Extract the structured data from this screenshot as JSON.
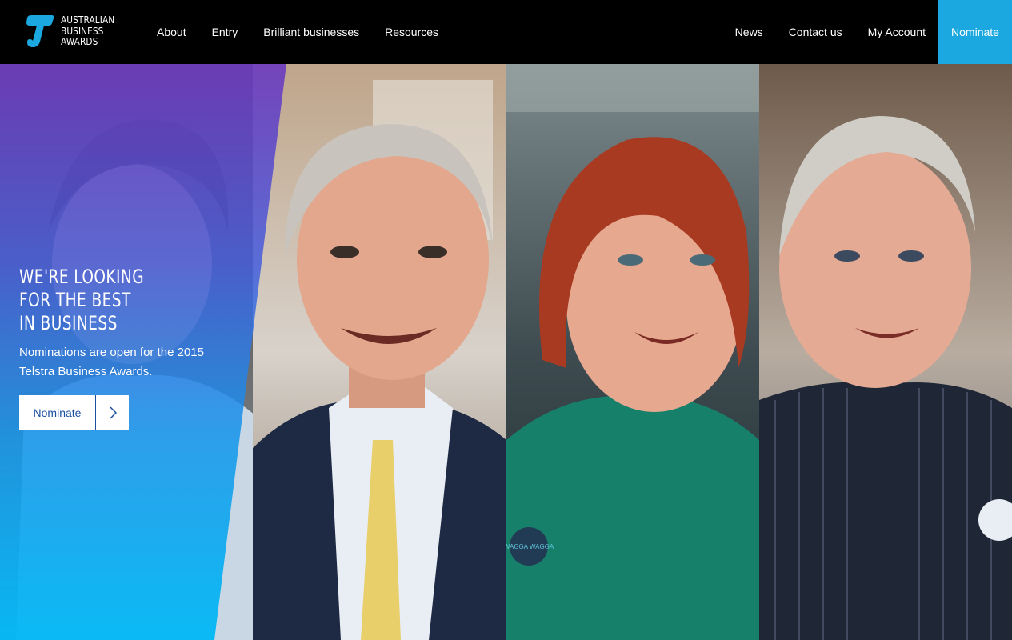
{
  "brand": {
    "logo_lines": [
      "AUSTRALIAN",
      "BUSINESS",
      "AWARDS"
    ],
    "logo_icon": "telstra-t-icon",
    "accent": "#1ba8e0"
  },
  "nav": {
    "left": [
      "About",
      "Entry",
      "Brilliant businesses",
      "Resources"
    ],
    "right": [
      "News",
      "Contact us",
      "My Account"
    ],
    "nominate_label": "Nominate"
  },
  "hero": {
    "title_lines": [
      "WE'RE LOOKING",
      "FOR THE BEST",
      "IN BUSINESS"
    ],
    "subtitle": "Nominations are open for the 2015 Telstra Business Awards.",
    "cta_label": "Nominate",
    "cta_icon": "chevron-right-icon",
    "badge_text": "WAGGA WAGGA"
  }
}
